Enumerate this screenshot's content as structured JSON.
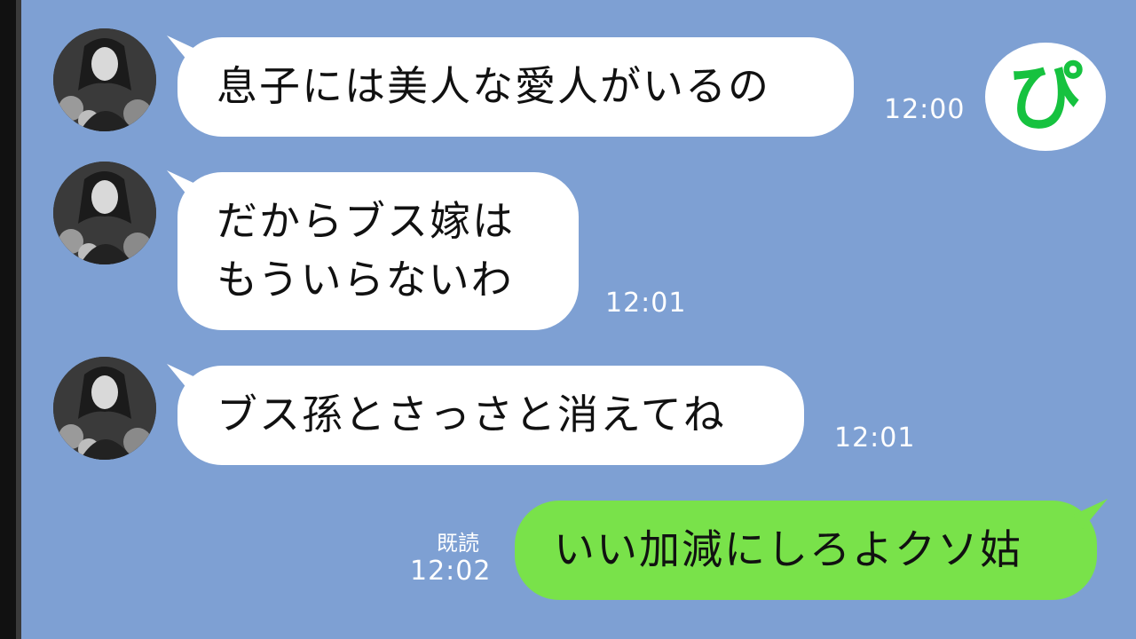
{
  "chat": {
    "messages": [
      {
        "sender": "other",
        "lines": [
          "息子には美人な愛人がいるの"
        ],
        "time": "12:00"
      },
      {
        "sender": "other",
        "lines": [
          "だからブス嫁は",
          "もういらないわ"
        ],
        "time": "12:01"
      },
      {
        "sender": "other",
        "lines": [
          "ブス孫とさっさと消えてね"
        ],
        "time": "12:01"
      },
      {
        "sender": "me",
        "lines": [
          "いい加減にしろよクソ姑"
        ],
        "read_label": "既読",
        "time": "12:02"
      }
    ]
  },
  "logo": {
    "text": "ぴ",
    "color": "#16c23f"
  },
  "colors": {
    "background": "#7ea0d3",
    "incoming_bubble": "#ffffff",
    "outgoing_bubble": "#79e24a"
  },
  "icons": {
    "avatar": "avatar-photo",
    "logo": "pi-logo-icon"
  }
}
